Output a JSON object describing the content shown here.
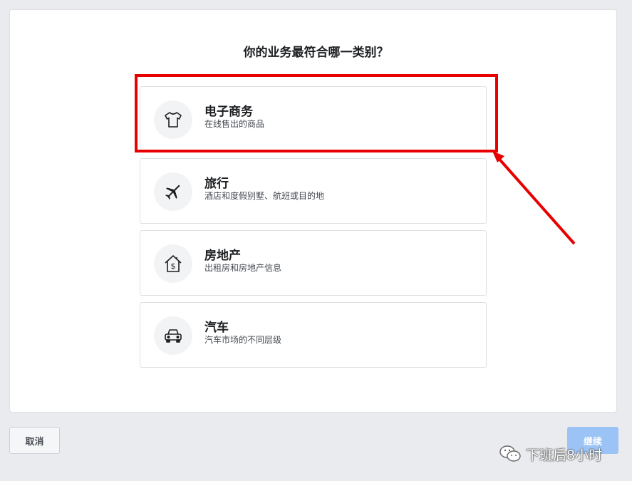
{
  "question": "你的业务最符合哪一类别？",
  "options": [
    {
      "title": "电子商务",
      "subtitle": "在线售出的商品",
      "icon": "tshirt-icon"
    },
    {
      "title": "旅行",
      "subtitle": "酒店和度假别墅、航班或目的地",
      "icon": "airplane-icon"
    },
    {
      "title": "房地产",
      "subtitle": "出租房和房地产信息",
      "icon": "house-dollar-icon"
    },
    {
      "title": "汽车",
      "subtitle": "汽车市场的不同层级",
      "icon": "car-icon"
    }
  ],
  "buttons": {
    "cancel": "取消",
    "continue": "继续"
  },
  "watermark": "下班后8小时",
  "colors": {
    "highlight": "#e80000",
    "continue_bg": "#9cc3f5",
    "page_bg": "#e9ebee"
  }
}
